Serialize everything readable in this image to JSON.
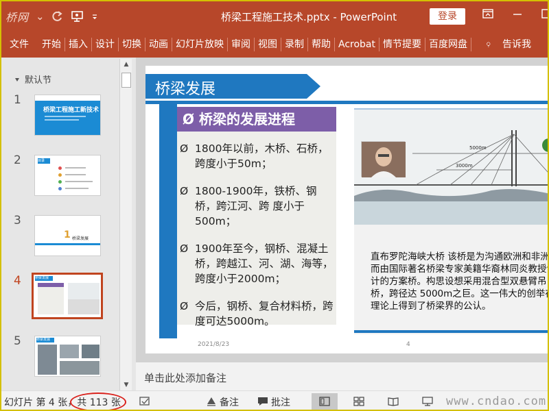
{
  "titlebar": {
    "watermark_logo": "桥网",
    "qat_dropdown": "⌄",
    "title": "桥梁工程施工技术.pptx  -  PowerPoint",
    "login": "登录",
    "accent": "#b7472a"
  },
  "tabs": [
    "文件",
    "开始",
    "插入",
    "设计",
    "切换",
    "动画",
    "幻灯片放映",
    "审阅",
    "视图",
    "录制",
    "帮助",
    "Acrobat",
    "情节提要",
    "百度网盘"
  ],
  "tell_me": "告诉我",
  "thumbnails": {
    "section_label": "默认节",
    "items": [
      {
        "num": "1",
        "title": "桥梁工程施工新技术"
      },
      {
        "num": "2",
        "title": "目录"
      },
      {
        "num": "3",
        "title": "桥梁发展"
      },
      {
        "num": "4",
        "title": "桥梁发展"
      },
      {
        "num": "5",
        "title": "桥梁发展"
      }
    ],
    "selected_index": 4
  },
  "slide": {
    "title": "桥梁发展",
    "subhead": "Ø 桥梁的发展进程",
    "bullets": [
      {
        "marker": "Ø",
        "text": "1800年以前，木桥、石桥，跨度小于50m；"
      },
      {
        "marker": "Ø",
        "text": "1800-1900年，铁桥、钢桥，跨江河、跨 度小于500m；"
      },
      {
        "marker": "Ø",
        "text": "1900年至今，钢桥、混凝土 桥，跨越江、河、湖、海等， 跨度小于2000m；"
      },
      {
        "marker": "Ø",
        "text": "今后，钢桥、复合材料桥，跨度可达5000m。"
      }
    ],
    "diagram_labels": {
      "span_5000": "5000m",
      "span_3000": "3000m"
    },
    "caption": "直布罗陀海峡大桥  该桥是为沟通欧洲和非洲而由国际著名桥梁专家美籍华裔林同炎教授设计的方案桥。构思设想采用混合型双悬臂吊桥，跨径达 5000m之巨。这一伟大的创举在理论上得到了桥梁界的公认。",
    "date": "2021/8/23",
    "page": "4"
  },
  "notes": {
    "placeholder": "单击此处添加备注"
  },
  "statusbar": {
    "slide_info": "幻灯片 第 4 张，共 113 张",
    "notes_btn": "备注",
    "comments_btn": "批注",
    "watermark": "www.cndao.com"
  }
}
